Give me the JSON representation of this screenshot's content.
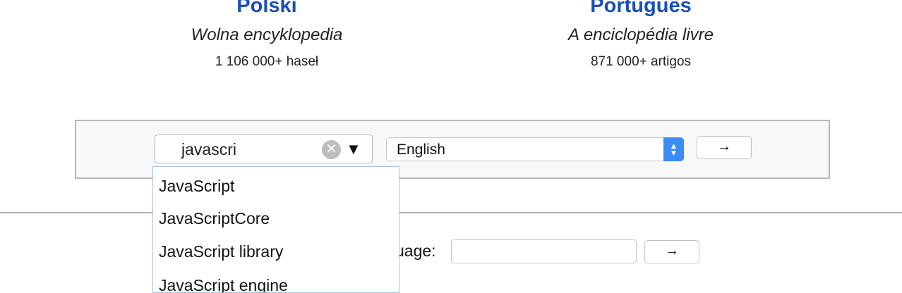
{
  "languages": [
    {
      "name": "Polski",
      "tagline": "Wolna encyklopedia",
      "count": "1 106 000+ haseł"
    },
    {
      "name": "Português",
      "tagline": "A enciclopédia livre",
      "count": "871 000+ artigos"
    }
  ],
  "search": {
    "value": "javascri",
    "clear_icon": "✕",
    "dropdown_icon": "▼",
    "language_selected": "English",
    "select_arrows": [
      "▲",
      "▼"
    ],
    "go_label": "→"
  },
  "suggestions": [
    "JavaScript",
    "JavaScriptCore",
    "JavaScript library",
    "JavaScript engine"
  ],
  "find_language": {
    "label": "uage:",
    "value": "",
    "go_label": "→"
  },
  "colors": {
    "link": "#1a4fb5",
    "accent": "#3b8df5"
  }
}
